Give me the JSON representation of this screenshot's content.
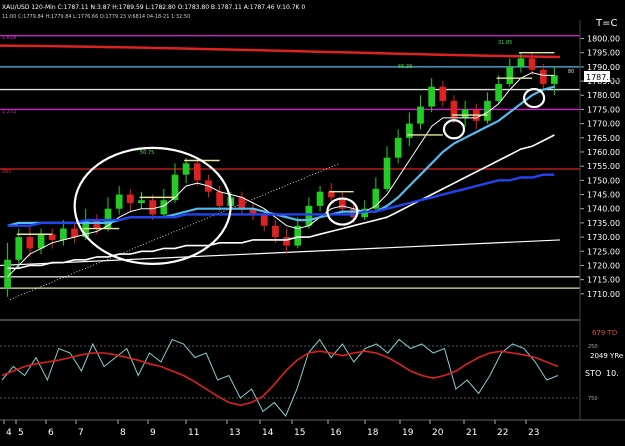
{
  "header": {
    "title_line": "XAU/USD 120-Min  C:1787.11  N:3.87  H:1789.59  L:1782.80  O:1783.80  B:1787.11  A:1787.46  V:10.7K  0",
    "sub_line": "11:00  C:1779.84  H:1779.84  L:1776.66  O:1779.23  V:6814  04-18-21  1:32:50",
    "corner_label": "T=C"
  },
  "level_labels": {
    "magenta_top": "1.618",
    "magenta_mid": "1.272",
    "red_mid": "000",
    "peak_a": "50.75",
    "peak_b": "66.38",
    "peak_c": "31.85",
    "price_tag_small": "80"
  },
  "colors": {
    "background": "#000000",
    "bull_candle": "#22cc22",
    "bear_candle": "#dd2222",
    "ema_fast": "#ffffff",
    "ema_mid": "#55bbee",
    "ema_slow": "#ffffff",
    "ema_long": "#2244ee",
    "resistance": "#dd2222",
    "fib": "#cc22cc",
    "support": "#dddddd",
    "dotted_support": "#ffffff",
    "marker": "#e8e8a0",
    "osc_red": "#dd2222",
    "osc_cyan": "#88cccc"
  },
  "chart_data": {
    "type": "candlestick",
    "title": "XAU/USD 120-Min",
    "ylabel": "",
    "ylim": [
      1705,
      1803
    ],
    "yticks": [
      1710,
      1715,
      1720,
      1725,
      1730,
      1735,
      1740,
      1745,
      1750,
      1755,
      1760,
      1765,
      1770,
      1775,
      1780,
      1785,
      1790,
      1795,
      1800
    ],
    "ytick_labels": [
      "1710.00",
      "1715.00",
      "1720.00",
      "1725.00",
      "1730.00",
      "1735.00",
      "1740.00",
      "1745.00",
      "1750.00",
      "1755.00",
      "1760.00",
      "1765.00",
      "1770.00",
      "1775.00",
      "1780.00",
      "1785.00",
      "1790.00",
      "1795.00",
      "1800.00"
    ],
    "xticks": [
      "4",
      "5",
      "6",
      "7",
      "8",
      "9",
      "11",
      "13",
      "14",
      "15",
      "16",
      "18",
      "19",
      "20",
      "21",
      "22",
      "23"
    ],
    "last_price": "1787.11",
    "horizontal_levels": [
      {
        "name": "fib-1.618",
        "value": 1801,
        "color": "#cc22cc"
      },
      {
        "name": "fib-1.272",
        "value": 1775,
        "color": "#cc22cc"
      },
      {
        "name": "resistance-red",
        "value": 1754,
        "color": "#dd2222"
      },
      {
        "name": "support-cyan",
        "value": 1790,
        "color": "#55bbee"
      },
      {
        "name": "support-white",
        "value": 1782,
        "color": "#dddddd"
      },
      {
        "name": "support-low-a",
        "value": 1716,
        "color": "#dddddd"
      },
      {
        "name": "support-low-b",
        "value": 1712,
        "color": "#e8e8a0"
      }
    ],
    "candles": [
      [
        1712,
        1722,
        1709,
        1728
      ],
      [
        1722,
        1730,
        1719,
        1733
      ],
      [
        1730,
        1726,
        1723,
        1734
      ],
      [
        1726,
        1731,
        1724,
        1733
      ],
      [
        1731,
        1729,
        1726,
        1733
      ],
      [
        1729,
        1733,
        1727,
        1736
      ],
      [
        1733,
        1730,
        1728,
        1735
      ],
      [
        1730,
        1736,
        1729,
        1740
      ],
      [
        1736,
        1733,
        1731,
        1738
      ],
      [
        1733,
        1740,
        1732,
        1744
      ],
      [
        1740,
        1745,
        1738,
        1748
      ],
      [
        1745,
        1742,
        1739,
        1747
      ],
      [
        1742,
        1743,
        1740,
        1746
      ],
      [
        1743,
        1738,
        1736,
        1745
      ],
      [
        1738,
        1743,
        1737,
        1747
      ],
      [
        1743,
        1752,
        1742,
        1756
      ],
      [
        1752,
        1756,
        1749,
        1758
      ],
      [
        1756,
        1750,
        1748,
        1757
      ],
      [
        1750,
        1746,
        1744,
        1752
      ],
      [
        1746,
        1741,
        1739,
        1748
      ],
      [
        1741,
        1744,
        1740,
        1746
      ],
      [
        1744,
        1740,
        1738,
        1746
      ],
      [
        1740,
        1738,
        1736,
        1742
      ],
      [
        1738,
        1734,
        1732,
        1740
      ],
      [
        1734,
        1730,
        1728,
        1736
      ],
      [
        1730,
        1727,
        1724,
        1733
      ],
      [
        1727,
        1734,
        1726,
        1737
      ],
      [
        1734,
        1741,
        1733,
        1744
      ],
      [
        1741,
        1746,
        1739,
        1748
      ],
      [
        1746,
        1744,
        1742,
        1749
      ],
      [
        1744,
        1740,
        1738,
        1746
      ],
      [
        1740,
        1737,
        1735,
        1742
      ],
      [
        1737,
        1740,
        1736,
        1743
      ],
      [
        1740,
        1747,
        1739,
        1751
      ],
      [
        1747,
        1758,
        1746,
        1762
      ],
      [
        1758,
        1765,
        1756,
        1768
      ],
      [
        1765,
        1770,
        1762,
        1774
      ],
      [
        1770,
        1776,
        1768,
        1780
      ],
      [
        1776,
        1783,
        1774,
        1786
      ],
      [
        1783,
        1778,
        1776,
        1785
      ],
      [
        1778,
        1772,
        1770,
        1780
      ],
      [
        1772,
        1775,
        1769,
        1778
      ],
      [
        1775,
        1771,
        1768,
        1777
      ],
      [
        1771,
        1778,
        1770,
        1781
      ],
      [
        1778,
        1784,
        1777,
        1787
      ],
      [
        1784,
        1790,
        1783,
        1793
      ],
      [
        1790,
        1793,
        1788,
        1795
      ],
      [
        1793,
        1789,
        1787,
        1795
      ],
      [
        1789,
        1784,
        1782,
        1791
      ],
      [
        1784,
        1787,
        1780,
        1790
      ]
    ],
    "series": [
      {
        "name": "ema-fast",
        "values": [
          1716,
          1720,
          1724,
          1726,
          1728,
          1729,
          1730,
          1731,
          1732,
          1734,
          1737,
          1739,
          1740,
          1740,
          1741,
          1744,
          1748,
          1749,
          1748,
          1746,
          1745,
          1744,
          1742,
          1740,
          1737,
          1734,
          1733,
          1734,
          1737,
          1740,
          1741,
          1740,
          1739,
          1741,
          1745,
          1751,
          1757,
          1763,
          1769,
          1772,
          1772,
          1772,
          1772,
          1774,
          1777,
          1782,
          1786,
          1788,
          1787,
          1787
        ]
      },
      {
        "name": "ema-mid",
        "values": [
          1734,
          1735,
          1735,
          1735,
          1735,
          1735,
          1735,
          1735,
          1735,
          1735,
          1736,
          1737,
          1737,
          1737,
          1737,
          1738,
          1739,
          1740,
          1740,
          1740,
          1740,
          1740,
          1740,
          1739,
          1738,
          1737,
          1736,
          1736,
          1737,
          1738,
          1739,
          1739,
          1739,
          1739,
          1741,
          1744,
          1748,
          1752,
          1756,
          1760,
          1763,
          1765,
          1767,
          1769,
          1771,
          1774,
          1777,
          1780,
          1782,
          1783
        ]
      },
      {
        "name": "ema-slow",
        "values": [
          1719,
          1719,
          1720,
          1720,
          1721,
          1721,
          1722,
          1722,
          1723,
          1723,
          1724,
          1724,
          1725,
          1725,
          1726,
          1726,
          1727,
          1727,
          1727,
          1728,
          1728,
          1728,
          1729,
          1729,
          1729,
          1729,
          1730,
          1730,
          1731,
          1732,
          1733,
          1734,
          1735,
          1736,
          1737,
          1739,
          1741,
          1743,
          1745,
          1747,
          1749,
          1751,
          1753,
          1755,
          1757,
          1759,
          1761,
          1762,
          1764,
          1766
        ]
      },
      {
        "name": "ema-long",
        "values": [
          1734,
          1734,
          1734,
          1735,
          1735,
          1735,
          1735,
          1736,
          1736,
          1736,
          1736,
          1737,
          1737,
          1737,
          1737,
          1737,
          1738,
          1738,
          1738,
          1738,
          1738,
          1738,
          1738,
          1738,
          1738,
          1738,
          1738,
          1738,
          1738,
          1738,
          1738,
          1738,
          1739,
          1739,
          1740,
          1741,
          1742,
          1743,
          1744,
          1745,
          1746,
          1747,
          1748,
          1749,
          1750,
          1750,
          1751,
          1751,
          1752,
          1752
        ]
      }
    ]
  },
  "oscillator": {
    "label_td": "679 TD",
    "label_yr": "2049 YRe",
    "label_sto": "STO",
    "label_sto_val": "10.",
    "tick_top": "250",
    "tick_bottom": "750",
    "red_values": [
      0.55,
      0.5,
      0.45,
      0.42,
      0.4,
      0.38,
      0.35,
      0.32,
      0.3,
      0.3,
      0.32,
      0.35,
      0.38,
      0.42,
      0.45,
      0.5,
      0.55,
      0.62,
      0.7,
      0.78,
      0.85,
      0.88,
      0.85,
      0.78,
      0.65,
      0.5,
      0.38,
      0.3,
      0.28,
      0.3,
      0.33,
      0.3,
      0.28,
      0.3,
      0.35,
      0.42,
      0.5,
      0.55,
      0.58,
      0.55,
      0.5,
      0.42,
      0.35,
      0.3,
      0.28,
      0.3,
      0.32,
      0.35,
      0.4,
      0.45
    ],
    "cyan_values": [
      0.6,
      0.45,
      0.55,
      0.35,
      0.6,
      0.25,
      0.3,
      0.5,
      0.2,
      0.45,
      0.35,
      0.25,
      0.55,
      0.3,
      0.4,
      0.15,
      0.2,
      0.35,
      0.3,
      0.6,
      0.55,
      0.8,
      0.7,
      0.95,
      0.85,
      1.0,
      0.7,
      0.3,
      0.15,
      0.35,
      0.2,
      0.4,
      0.25,
      0.2,
      0.3,
      0.15,
      0.25,
      0.2,
      0.3,
      0.25,
      0.7,
      0.6,
      0.75,
      0.55,
      0.3,
      0.2,
      0.25,
      0.4,
      0.6,
      0.55
    ]
  }
}
